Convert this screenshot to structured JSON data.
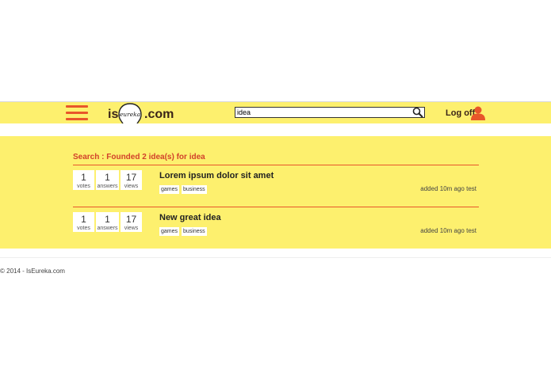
{
  "header": {
    "logo_prefix": "is",
    "logo_bulb_word": "eureka",
    "logo_suffix": ".com",
    "search_value": "idea",
    "logoff_label": "Log off"
  },
  "colors": {
    "band": "#fdf06e",
    "accent": "#e8562a",
    "title_red": "#d2412a"
  },
  "results": {
    "title": "Search : Founded 2 idea(s) for idea",
    "items": [
      {
        "votes": "1",
        "votes_label": "votes",
        "answers": "1",
        "answers_label": "answers",
        "views": "17",
        "views_label": "views",
        "title": "Lorem ipsum dolor sit amet",
        "tags": [
          "games",
          "business"
        ],
        "meta": "added 10m ago test"
      },
      {
        "votes": "1",
        "votes_label": "votes",
        "answers": "1",
        "answers_label": "answers",
        "views": "17",
        "views_label": "views",
        "title": "New great idea",
        "tags": [
          "games",
          "business"
        ],
        "meta": "added 10m ago test"
      }
    ]
  },
  "footer": {
    "text": "© 2014 - IsEureka.com"
  }
}
